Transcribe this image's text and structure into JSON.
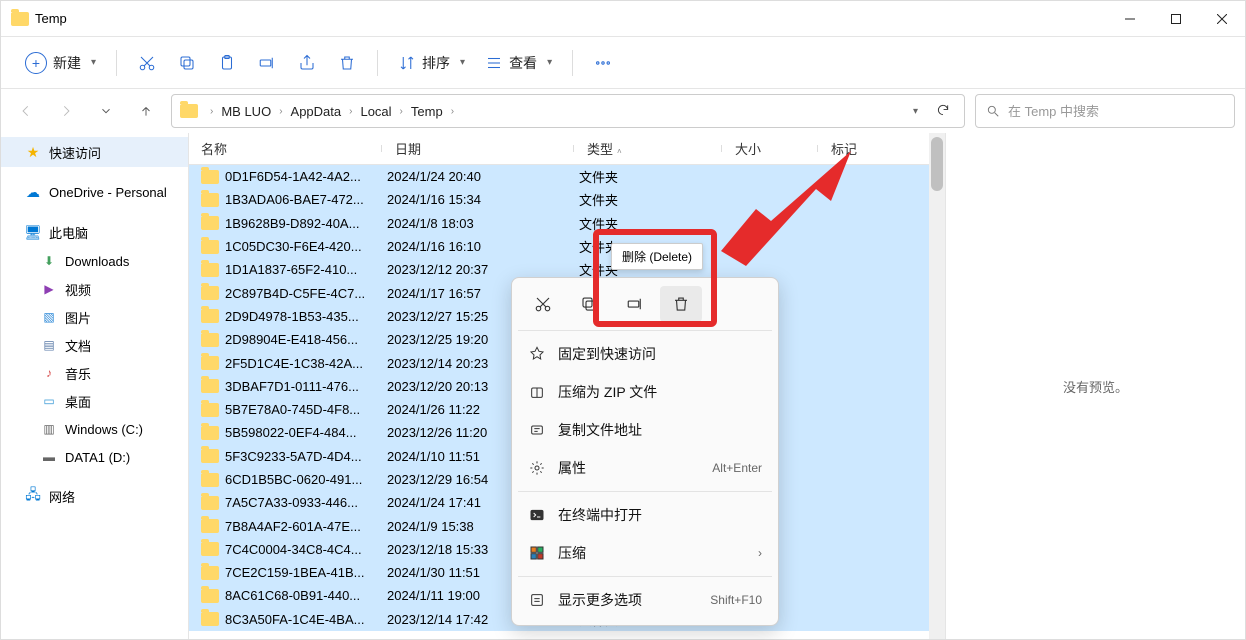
{
  "window": {
    "title": "Temp"
  },
  "toolbar": {
    "new_label": "新建",
    "sort_label": "排序",
    "view_label": "查看"
  },
  "breadcrumb": {
    "segments": [
      "MB LUO",
      "AppData",
      "Local",
      "Temp"
    ]
  },
  "search": {
    "placeholder": "在 Temp 中搜索"
  },
  "sidebar": {
    "quick_access": "快速访问",
    "onedrive": "OneDrive - Personal",
    "this_pc": "此电脑",
    "downloads": "Downloads",
    "videos": "视频",
    "pictures": "图片",
    "documents": "文档",
    "music": "音乐",
    "desktop": "桌面",
    "drive_c": "Windows (C:)",
    "drive_d": "DATA1 (D:)",
    "network": "网络"
  },
  "columns": {
    "name": "名称",
    "date": "日期",
    "type": "类型",
    "size": "大小",
    "tag": "标记"
  },
  "type_folder": "文件夹",
  "rows": [
    {
      "name": "0D1F6D54-1A42-4A2...",
      "date": "2024/1/24 20:40"
    },
    {
      "name": "1B3ADA06-BAE7-472...",
      "date": "2024/1/16 15:34"
    },
    {
      "name": "1B9628B9-D892-40A...",
      "date": "2024/1/8 18:03"
    },
    {
      "name": "1C05DC30-F6E4-420...",
      "date": "2024/1/16 16:10"
    },
    {
      "name": "1D1A1837-65F2-410...",
      "date": "2023/12/12 20:37"
    },
    {
      "name": "2C897B4D-C5FE-4C7...",
      "date": "2024/1/17 16:57"
    },
    {
      "name": "2D9D4978-1B53-435...",
      "date": "2023/12/27 15:25"
    },
    {
      "name": "2D98904E-E418-456...",
      "date": "2023/12/25 19:20"
    },
    {
      "name": "2F5D1C4E-1C38-42A...",
      "date": "2023/12/14 20:23"
    },
    {
      "name": "3DBAF7D1-0111-476...",
      "date": "2023/12/20 20:13"
    },
    {
      "name": "5B7E78A0-745D-4F8...",
      "date": "2024/1/26 11:22"
    },
    {
      "name": "5B598022-0EF4-484...",
      "date": "2023/12/26 11:20"
    },
    {
      "name": "5F3C9233-5A7D-4D4...",
      "date": "2024/1/10 11:51"
    },
    {
      "name": "6CD1B5BC-0620-491...",
      "date": "2023/12/29 16:54"
    },
    {
      "name": "7A5C7A33-0933-446...",
      "date": "2024/1/24 17:41"
    },
    {
      "name": "7B8A4AF2-601A-47E...",
      "date": "2024/1/9 15:38"
    },
    {
      "name": "7C4C0004-34C8-4C4...",
      "date": "2023/12/18 15:33"
    },
    {
      "name": "7CE2C159-1BEA-41B...",
      "date": "2024/1/30 11:51"
    },
    {
      "name": "8AC61C68-0B91-440...",
      "date": "2024/1/11 19:00"
    },
    {
      "name": "8C3A50FA-1C4E-4BA...",
      "date": "2023/12/14 17:42"
    }
  ],
  "preview": {
    "empty": "没有预览。"
  },
  "tooltip": {
    "delete": "删除 (Delete)"
  },
  "context_menu": {
    "pin": "固定到快速访问",
    "zip": "压缩为 ZIP 文件",
    "copy_path": "复制文件地址",
    "properties": "属性",
    "properties_key": "Alt+Enter",
    "terminal": "在终端中打开",
    "compress": "压缩",
    "more": "显示更多选项",
    "more_key": "Shift+F10"
  }
}
